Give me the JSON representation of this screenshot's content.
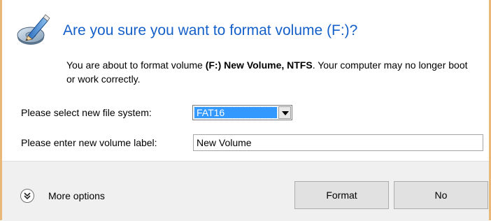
{
  "header": {
    "title": "Are you sure you want to format volume (F:)?",
    "icon": "format-disk-icon"
  },
  "message": {
    "prefix": "You are about to format volume ",
    "volume": "(F:) New Volume, NTFS",
    "suffix": ". Your computer may no longer boot or work correctly."
  },
  "form": {
    "filesystem_label": "Please select new file system:",
    "filesystem_value": "FAT16",
    "volume_label_label": "Please enter new volume label:",
    "volume_label_value": "New Volume"
  },
  "footer": {
    "more_options": "More options",
    "more_icon": "double-chevron-down-icon",
    "format_button": "Format",
    "no_button": "No"
  },
  "colors": {
    "title": "#1560c8",
    "selection": "#3399ff",
    "frame": "#e8b87a"
  }
}
